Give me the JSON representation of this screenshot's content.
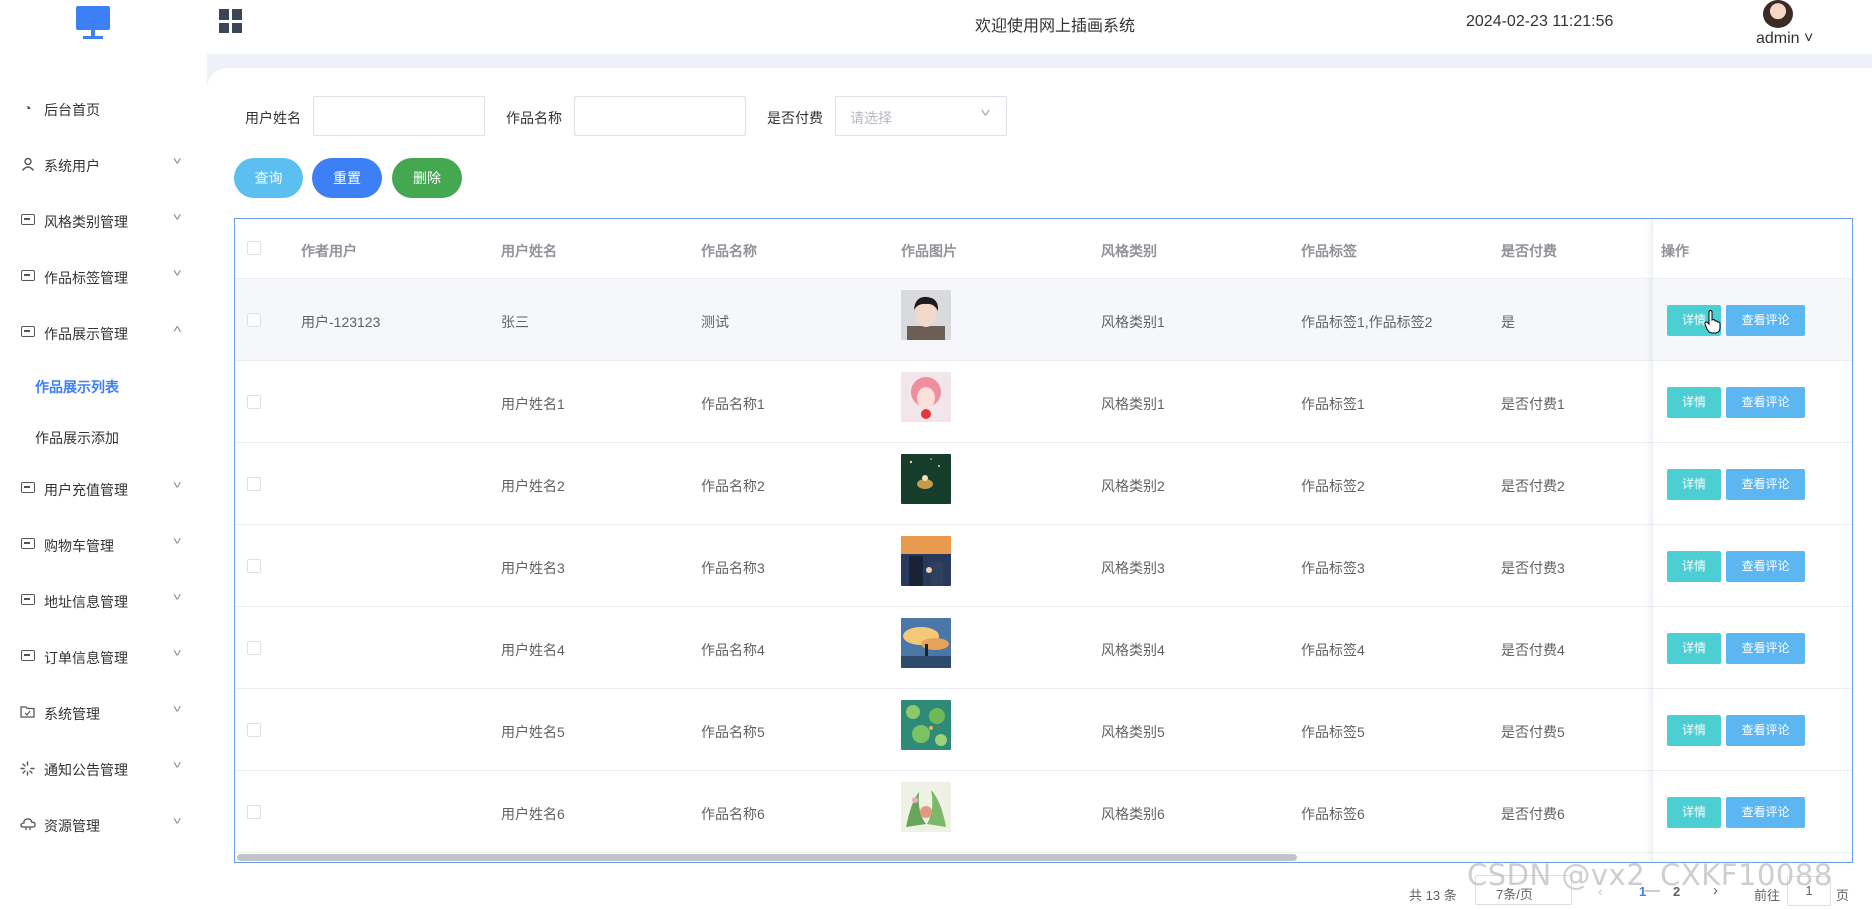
{
  "header": {
    "welcome": "欢迎使用网上插画系统",
    "datetime": "2024-02-23 11:21:56",
    "user": "admin ˅"
  },
  "sidebar": {
    "items": [
      {
        "label": "后台首页",
        "icon": "clock-icon"
      },
      {
        "label": "系统用户",
        "icon": "user-icon"
      },
      {
        "label": "风格类别管理",
        "icon": "card-icon"
      },
      {
        "label": "作品标签管理",
        "icon": "card-icon"
      },
      {
        "label": "作品展示管理",
        "icon": "card-icon",
        "expanded": true
      },
      {
        "label": "用户充值管理",
        "icon": "card-icon"
      },
      {
        "label": "购物车管理",
        "icon": "card-icon"
      },
      {
        "label": "地址信息管理",
        "icon": "card-icon"
      },
      {
        "label": "订单信息管理",
        "icon": "card-icon"
      },
      {
        "label": "系统管理",
        "icon": "folder-icon"
      },
      {
        "label": "通知公告管理",
        "icon": "loading-icon"
      },
      {
        "label": "资源管理",
        "icon": "cloud-icon"
      }
    ],
    "sub_items": [
      {
        "label": "作品展示列表",
        "active": true
      },
      {
        "label": "作品展示添加",
        "active": false
      }
    ]
  },
  "filters": {
    "username_label": "用户姓名",
    "workname_label": "作品名称",
    "paid_label": "是否付费",
    "paid_placeholder": "请选择"
  },
  "buttons": {
    "query": "查询",
    "reset": "重置",
    "delete": "删除"
  },
  "table": {
    "headers": [
      "作者用户",
      "用户姓名",
      "作品名称",
      "作品图片",
      "风格类别",
      "作品标签",
      "是否付费",
      "操作"
    ],
    "rows": [
      {
        "author": "用户-123123",
        "name": "张三",
        "work": "测试",
        "style": "风格类别1",
        "tags": "作品标签1,作品标签2",
        "paid": "是"
      },
      {
        "author": "",
        "name": "用户姓名1",
        "work": "作品名称1",
        "style": "风格类别1",
        "tags": "作品标签1",
        "paid": "是否付费1"
      },
      {
        "author": "",
        "name": "用户姓名2",
        "work": "作品名称2",
        "style": "风格类别2",
        "tags": "作品标签2",
        "paid": "是否付费2"
      },
      {
        "author": "",
        "name": "用户姓名3",
        "work": "作品名称3",
        "style": "风格类别3",
        "tags": "作品标签3",
        "paid": "是否付费3"
      },
      {
        "author": "",
        "name": "用户姓名4",
        "work": "作品名称4",
        "style": "风格类别4",
        "tags": "作品标签4",
        "paid": "是否付费4"
      },
      {
        "author": "",
        "name": "用户姓名5",
        "work": "作品名称5",
        "style": "风格类别5",
        "tags": "作品标签5",
        "paid": "是否付费5"
      },
      {
        "author": "",
        "name": "用户姓名6",
        "work": "作品名称6",
        "style": "风格类别6",
        "tags": "作品标签6",
        "paid": "是否付费6"
      }
    ],
    "detail_label": "详情",
    "review_label": "查看评论"
  },
  "pagination": {
    "total": "共 13 条",
    "page_size": "7条/页",
    "pages": [
      "1",
      "2"
    ],
    "current": "1",
    "goto_label": "前往",
    "goto_value": "1",
    "page_suffix": "页"
  },
  "watermark": "CSDN @vx2_CXKF10088",
  "colors": {
    "primary": "#3d7ff5",
    "query": "#5bc0f0",
    "delete": "#44a850",
    "detail": "#4ccfd2",
    "review": "#5bb6f2"
  }
}
